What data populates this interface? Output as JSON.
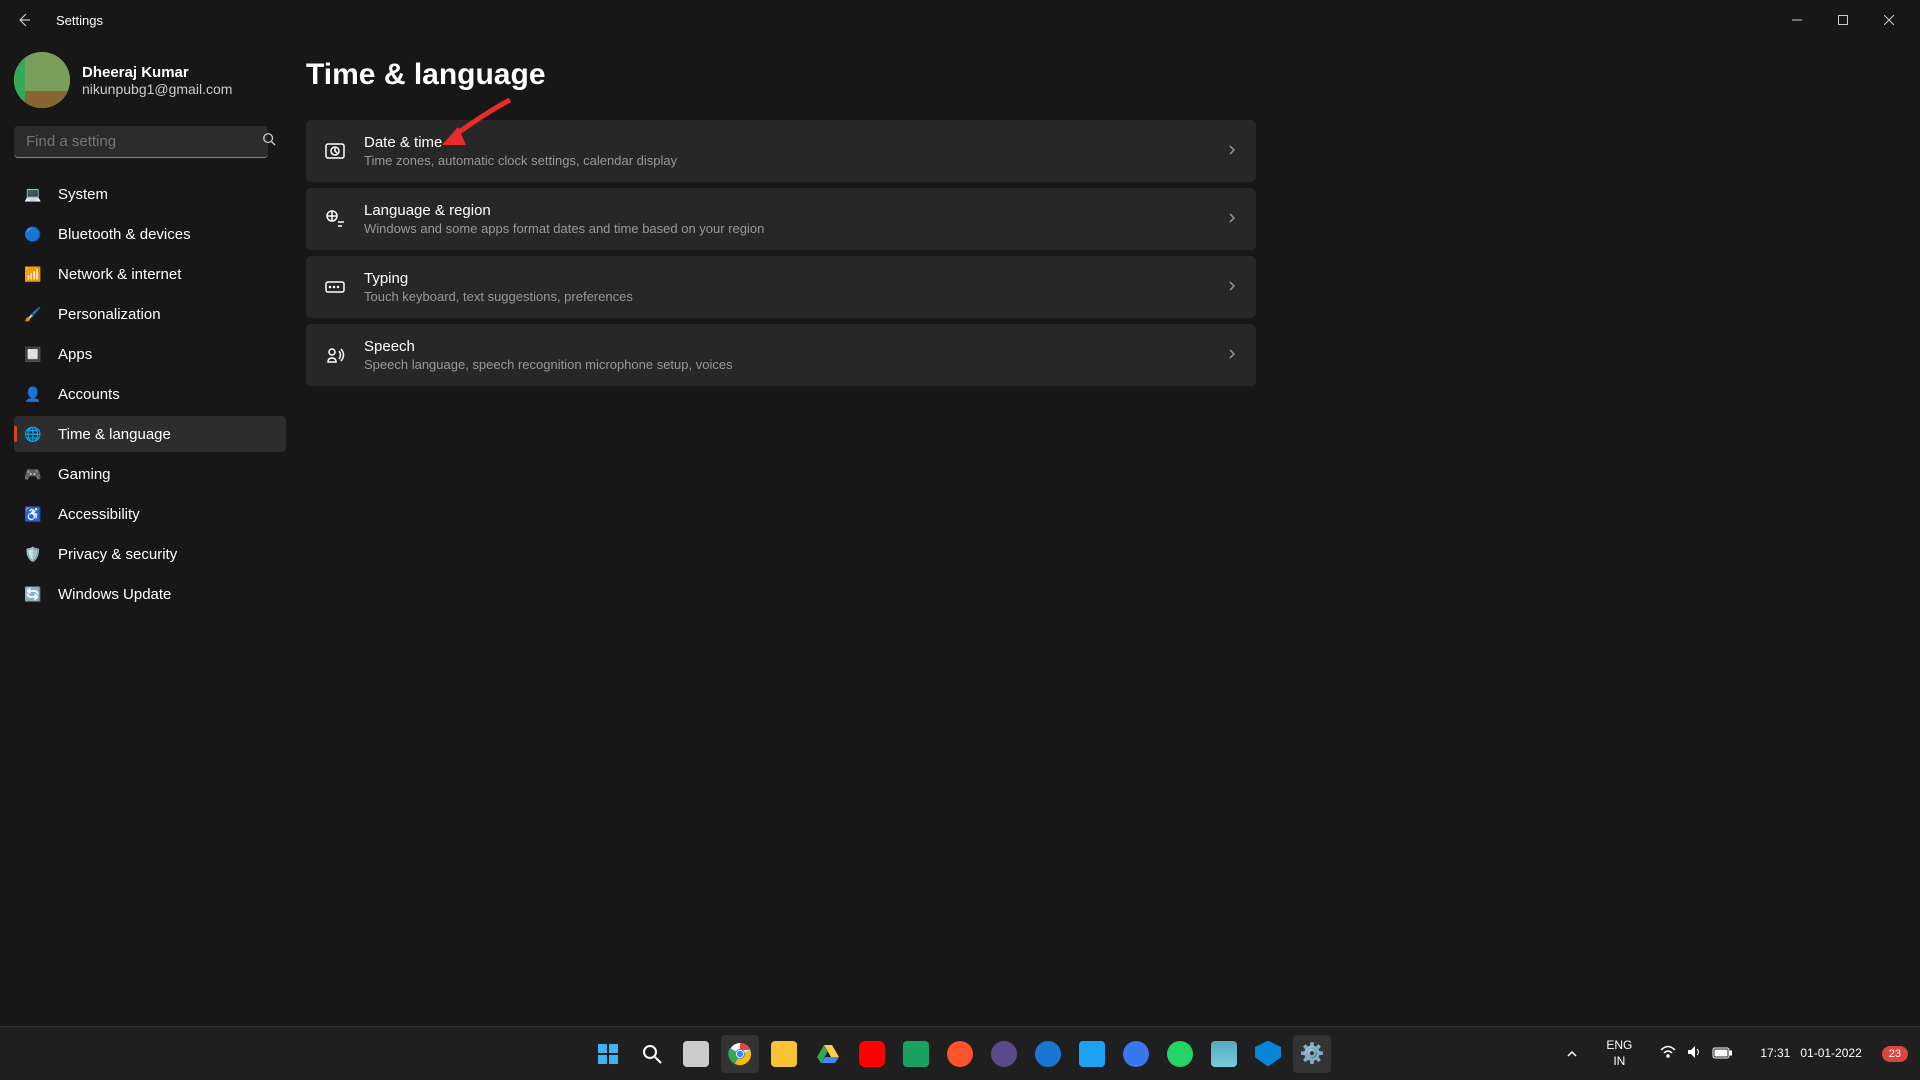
{
  "titlebar": {
    "title": "Settings"
  },
  "profile": {
    "name": "Dheeraj Kumar",
    "email": "nikunpubg1@gmail.com"
  },
  "search": {
    "placeholder": "Find a setting"
  },
  "nav": {
    "items": [
      {
        "label": "System",
        "icon": "💻"
      },
      {
        "label": "Bluetooth & devices",
        "icon": "🔵"
      },
      {
        "label": "Network & internet",
        "icon": "📶"
      },
      {
        "label": "Personalization",
        "icon": "🖌️"
      },
      {
        "label": "Apps",
        "icon": "🔲"
      },
      {
        "label": "Accounts",
        "icon": "👤"
      },
      {
        "label": "Time & language",
        "icon": "🌐"
      },
      {
        "label": "Gaming",
        "icon": "🎮"
      },
      {
        "label": "Accessibility",
        "icon": "♿"
      },
      {
        "label": "Privacy & security",
        "icon": "🛡️"
      },
      {
        "label": "Windows Update",
        "icon": "🔄"
      }
    ],
    "active_index": 6
  },
  "page": {
    "title": "Time & language"
  },
  "cards": [
    {
      "title": "Date & time",
      "desc": "Time zones, automatic clock settings, calendar display"
    },
    {
      "title": "Language & region",
      "desc": "Windows and some apps format dates and time based on your region"
    },
    {
      "title": "Typing",
      "desc": "Touch keyboard, text suggestions, preferences"
    },
    {
      "title": "Speech",
      "desc": "Speech language, speech recognition microphone setup, voices"
    }
  ],
  "taskbar": {
    "lang1": "ENG",
    "lang2": "IN",
    "time": "17:31",
    "date": "01-01-2022",
    "notification_count": "23"
  }
}
